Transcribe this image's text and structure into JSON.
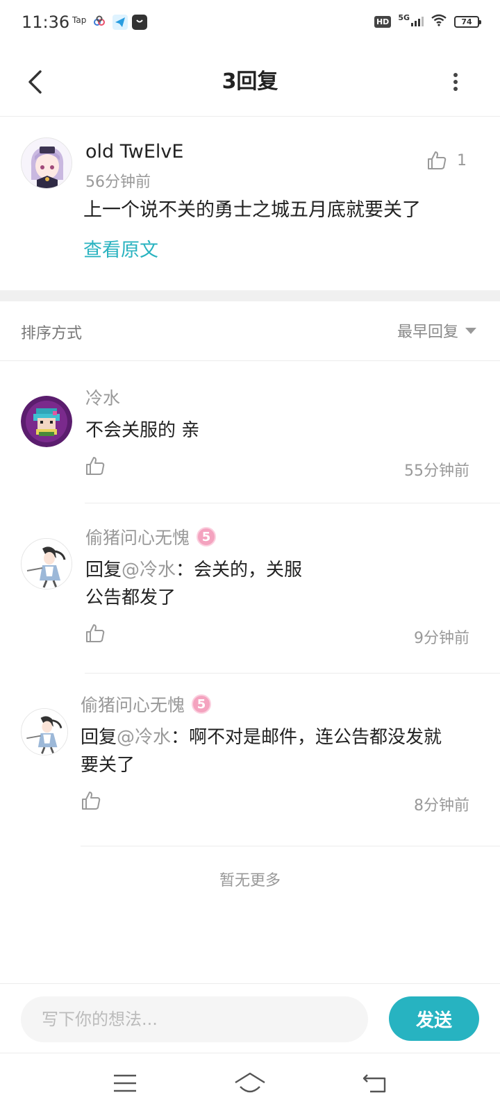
{
  "status_bar": {
    "time": "11:36",
    "app_icons": [
      "Tap"
    ],
    "hd": "HD",
    "network": "5G",
    "battery": "74"
  },
  "nav": {
    "title": "3回复"
  },
  "main_comment": {
    "author": "old TwElvE",
    "time": "56分钟前",
    "likes": "1",
    "text": "上一个说不关的勇士之城五月底就要关了",
    "view_original": "查看原文"
  },
  "sort": {
    "label": "排序方式",
    "selected": "最早回复"
  },
  "replies": [
    {
      "author": "冷水",
      "text": "不会关服的 亲",
      "time": "55分钟前"
    },
    {
      "author": "偷猪问心无愧",
      "level": "5",
      "reply_prefix": "回复",
      "mention": "@冷水",
      "text_line1": "：会关的，关服",
      "text_line2": "公告都发了",
      "time": "9分钟前"
    },
    {
      "author": "偷猪问心无愧",
      "level": "5",
      "reply_prefix": "回复",
      "mention": "@冷水",
      "text_line1": "：啊不对是邮件，连公告都没发就",
      "text_line2": "要关了",
      "time": "8分钟前"
    }
  ],
  "footer": {
    "no_more": "暂无更多"
  },
  "input": {
    "placeholder": "写下你的想法...",
    "send_label": "发送"
  },
  "colors": {
    "accent": "#27b3c1",
    "link": "#2ab3c0",
    "level_badge": "#f4a3bf"
  }
}
